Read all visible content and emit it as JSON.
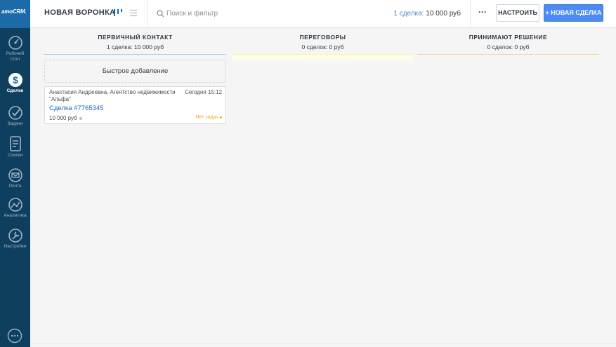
{
  "app": {
    "logo_text": "amoCRM."
  },
  "sidebar": {
    "items": [
      {
        "label": "Рабочий стол",
        "icon": "dashboard-icon"
      },
      {
        "label": "Сделки",
        "icon": "deals-icon",
        "active": true
      },
      {
        "label": "Задачи",
        "icon": "tasks-icon"
      },
      {
        "label": "Списки",
        "icon": "lists-icon"
      },
      {
        "label": "Почта",
        "icon": "mail-icon"
      },
      {
        "label": "Аналитика",
        "icon": "analytics-icon"
      },
      {
        "label": "Настройки",
        "icon": "settings-icon"
      }
    ],
    "chat_icon": "chat-icon"
  },
  "header": {
    "pipeline_title": "НОВАЯ ВОРОНКА",
    "search": {
      "placeholder": "Поиск и фильтр",
      "value": ""
    },
    "summary": {
      "count": "1 сделка:",
      "amount": "10 000 руб"
    },
    "more_label": "···",
    "configure_label": "НАСТРОИТЬ",
    "new_deal_label": "+ НОВАЯ СДЕЛКА"
  },
  "columns": [
    {
      "title": "ПЕРВИЧНЫЙ КОНТАКТ",
      "summary": "1 сделка: 10 000 руб",
      "accent": "#99ccff"
    },
    {
      "title": "ПЕРЕГОВОРЫ",
      "summary": "0 сделок: 0 руб",
      "accent": "#fffd7f"
    },
    {
      "title": "ПРИНИМАЮТ РЕШЕНИЕ",
      "summary": "0 сделок: 0 руб",
      "accent": "#fbd38a"
    }
  ],
  "quick_add_label": "Быстрое добавление",
  "cards": [
    {
      "contact": "Анастасия Андреевна, Агентство недвижимости \"Альфа\"",
      "time": "Сегодня 15:12",
      "deal": "Сделка #7765345",
      "price": "10 000 руб",
      "tasks": "Нет задач"
    }
  ]
}
